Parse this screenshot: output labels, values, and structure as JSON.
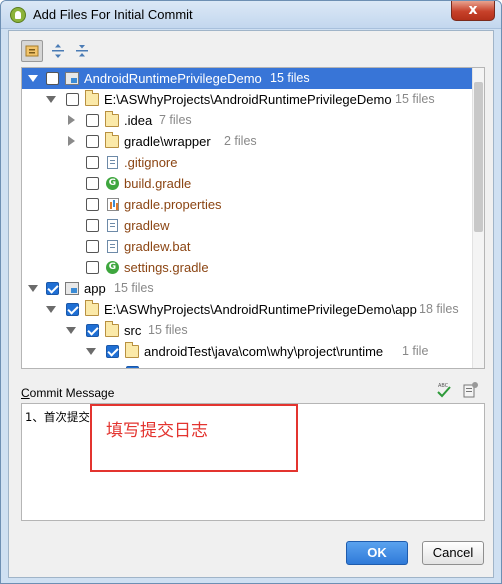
{
  "window": {
    "title": "Add Files For Initial Commit",
    "close_glyph": "x"
  },
  "toolbar": {
    "icons": [
      "group-by-directory-icon",
      "expand-all-icon",
      "collapse-all-icon"
    ]
  },
  "tree": {
    "rows": [
      {
        "name": "AndroidRuntimePrivilegeDemo",
        "count": "15 files"
      },
      {
        "name": "E:\\ASWhyProjects\\AndroidRuntimePrivilegeDemo",
        "count": "15 files"
      },
      {
        "name": ".idea",
        "count": "7 files"
      },
      {
        "name": "gradle\\wrapper",
        "count": "2 files"
      },
      {
        "name": ".gitignore",
        "count": ""
      },
      {
        "name": "build.gradle",
        "count": ""
      },
      {
        "name": "gradle.properties",
        "count": ""
      },
      {
        "name": "gradlew",
        "count": ""
      },
      {
        "name": "gradlew.bat",
        "count": ""
      },
      {
        "name": "settings.gradle",
        "count": ""
      },
      {
        "name": "app",
        "count": "15 files"
      },
      {
        "name": "E:\\ASWhyProjects\\AndroidRuntimePrivilegeDemo\\app",
        "count": "18 files"
      },
      {
        "name": "src",
        "count": "15 files"
      },
      {
        "name": "androidTest\\java\\com\\why\\project\\runtime",
        "count": "1 file"
      }
    ]
  },
  "commit": {
    "label_prefix": "C",
    "label_rest": "ommit Message",
    "message": "1、首次提交",
    "annotation": "填写提交日志"
  },
  "buttons": {
    "ok": "OK",
    "cancel": "Cancel"
  },
  "colors": {
    "selection": "#3875d7",
    "checkbox": "#1f6fd4",
    "annotation": "#e3342f",
    "ok_button": "#2f7ad8"
  }
}
